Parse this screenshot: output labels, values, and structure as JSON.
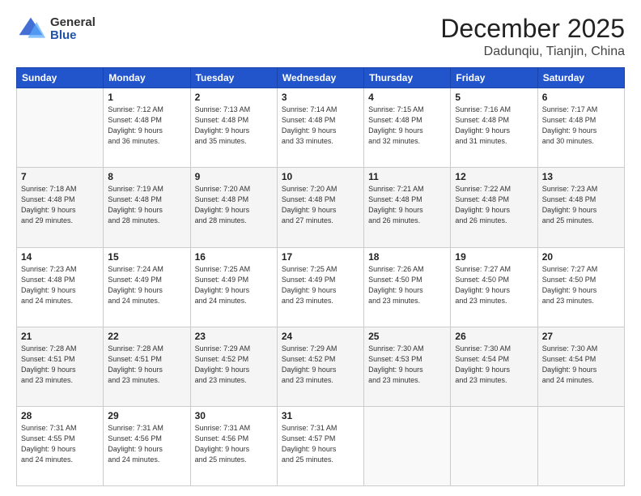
{
  "logo": {
    "general": "General",
    "blue": "Blue"
  },
  "header": {
    "month": "December 2025",
    "location": "Dadunqiu, Tianjin, China"
  },
  "weekdays": [
    "Sunday",
    "Monday",
    "Tuesday",
    "Wednesday",
    "Thursday",
    "Friday",
    "Saturday"
  ],
  "weeks": [
    [
      {
        "day": "",
        "info": ""
      },
      {
        "day": "1",
        "info": "Sunrise: 7:12 AM\nSunset: 4:48 PM\nDaylight: 9 hours\nand 36 minutes."
      },
      {
        "day": "2",
        "info": "Sunrise: 7:13 AM\nSunset: 4:48 PM\nDaylight: 9 hours\nand 35 minutes."
      },
      {
        "day": "3",
        "info": "Sunrise: 7:14 AM\nSunset: 4:48 PM\nDaylight: 9 hours\nand 33 minutes."
      },
      {
        "day": "4",
        "info": "Sunrise: 7:15 AM\nSunset: 4:48 PM\nDaylight: 9 hours\nand 32 minutes."
      },
      {
        "day": "5",
        "info": "Sunrise: 7:16 AM\nSunset: 4:48 PM\nDaylight: 9 hours\nand 31 minutes."
      },
      {
        "day": "6",
        "info": "Sunrise: 7:17 AM\nSunset: 4:48 PM\nDaylight: 9 hours\nand 30 minutes."
      }
    ],
    [
      {
        "day": "7",
        "info": "Sunrise: 7:18 AM\nSunset: 4:48 PM\nDaylight: 9 hours\nand 29 minutes."
      },
      {
        "day": "8",
        "info": "Sunrise: 7:19 AM\nSunset: 4:48 PM\nDaylight: 9 hours\nand 28 minutes."
      },
      {
        "day": "9",
        "info": "Sunrise: 7:20 AM\nSunset: 4:48 PM\nDaylight: 9 hours\nand 28 minutes."
      },
      {
        "day": "10",
        "info": "Sunrise: 7:20 AM\nSunset: 4:48 PM\nDaylight: 9 hours\nand 27 minutes."
      },
      {
        "day": "11",
        "info": "Sunrise: 7:21 AM\nSunset: 4:48 PM\nDaylight: 9 hours\nand 26 minutes."
      },
      {
        "day": "12",
        "info": "Sunrise: 7:22 AM\nSunset: 4:48 PM\nDaylight: 9 hours\nand 26 minutes."
      },
      {
        "day": "13",
        "info": "Sunrise: 7:23 AM\nSunset: 4:48 PM\nDaylight: 9 hours\nand 25 minutes."
      }
    ],
    [
      {
        "day": "14",
        "info": "Sunrise: 7:23 AM\nSunset: 4:48 PM\nDaylight: 9 hours\nand 24 minutes."
      },
      {
        "day": "15",
        "info": "Sunrise: 7:24 AM\nSunset: 4:49 PM\nDaylight: 9 hours\nand 24 minutes."
      },
      {
        "day": "16",
        "info": "Sunrise: 7:25 AM\nSunset: 4:49 PM\nDaylight: 9 hours\nand 24 minutes."
      },
      {
        "day": "17",
        "info": "Sunrise: 7:25 AM\nSunset: 4:49 PM\nDaylight: 9 hours\nand 23 minutes."
      },
      {
        "day": "18",
        "info": "Sunrise: 7:26 AM\nSunset: 4:50 PM\nDaylight: 9 hours\nand 23 minutes."
      },
      {
        "day": "19",
        "info": "Sunrise: 7:27 AM\nSunset: 4:50 PM\nDaylight: 9 hours\nand 23 minutes."
      },
      {
        "day": "20",
        "info": "Sunrise: 7:27 AM\nSunset: 4:50 PM\nDaylight: 9 hours\nand 23 minutes."
      }
    ],
    [
      {
        "day": "21",
        "info": "Sunrise: 7:28 AM\nSunset: 4:51 PM\nDaylight: 9 hours\nand 23 minutes."
      },
      {
        "day": "22",
        "info": "Sunrise: 7:28 AM\nSunset: 4:51 PM\nDaylight: 9 hours\nand 23 minutes."
      },
      {
        "day": "23",
        "info": "Sunrise: 7:29 AM\nSunset: 4:52 PM\nDaylight: 9 hours\nand 23 minutes."
      },
      {
        "day": "24",
        "info": "Sunrise: 7:29 AM\nSunset: 4:52 PM\nDaylight: 9 hours\nand 23 minutes."
      },
      {
        "day": "25",
        "info": "Sunrise: 7:30 AM\nSunset: 4:53 PM\nDaylight: 9 hours\nand 23 minutes."
      },
      {
        "day": "26",
        "info": "Sunrise: 7:30 AM\nSunset: 4:54 PM\nDaylight: 9 hours\nand 23 minutes."
      },
      {
        "day": "27",
        "info": "Sunrise: 7:30 AM\nSunset: 4:54 PM\nDaylight: 9 hours\nand 24 minutes."
      }
    ],
    [
      {
        "day": "28",
        "info": "Sunrise: 7:31 AM\nSunset: 4:55 PM\nDaylight: 9 hours\nand 24 minutes."
      },
      {
        "day": "29",
        "info": "Sunrise: 7:31 AM\nSunset: 4:56 PM\nDaylight: 9 hours\nand 24 minutes."
      },
      {
        "day": "30",
        "info": "Sunrise: 7:31 AM\nSunset: 4:56 PM\nDaylight: 9 hours\nand 25 minutes."
      },
      {
        "day": "31",
        "info": "Sunrise: 7:31 AM\nSunset: 4:57 PM\nDaylight: 9 hours\nand 25 minutes."
      },
      {
        "day": "",
        "info": ""
      },
      {
        "day": "",
        "info": ""
      },
      {
        "day": "",
        "info": ""
      }
    ]
  ]
}
